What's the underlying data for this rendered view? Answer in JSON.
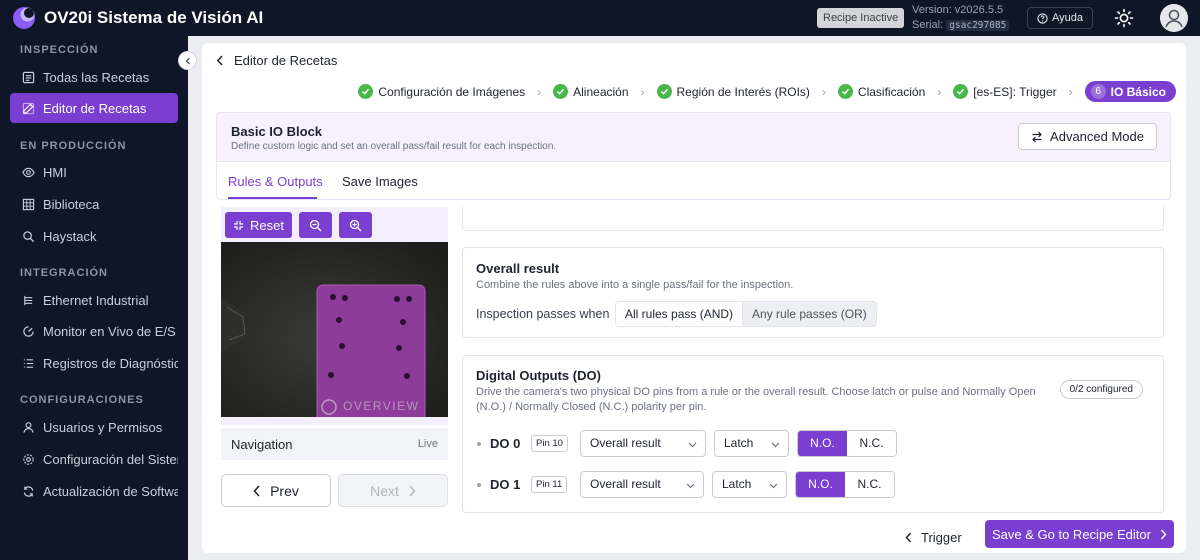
{
  "app": {
    "title": "OV20i Sistema de Visión AI",
    "recipe_status": "Recipe Inactive",
    "version": "Version: v2026.5.5",
    "serial_label": "Serial:",
    "serial_value": "gsac297085",
    "help_label": "Ayuda"
  },
  "sidebar": {
    "sections": [
      {
        "title": "INSPECCIÓN",
        "items": [
          {
            "label": "Todas las Recetas",
            "icon": "list-icon"
          },
          {
            "label": "Editor de Recetas",
            "icon": "edit-icon",
            "active": true
          }
        ]
      },
      {
        "title": "EN PRODUCCIÓN",
        "items": [
          {
            "label": "HMI",
            "icon": "eye-icon"
          },
          {
            "label": "Biblioteca",
            "icon": "grid-icon"
          },
          {
            "label": "Haystack",
            "icon": "search-icon"
          }
        ]
      },
      {
        "title": "INTEGRACIÓN",
        "items": [
          {
            "label": "Ethernet Industrial",
            "icon": "network-icon"
          },
          {
            "label": "Monitor en Vivo de E/S",
            "icon": "gauge-icon"
          },
          {
            "label": "Registros de Diagnóstico",
            "icon": "log-icon"
          }
        ]
      },
      {
        "title": "CONFIGURACIONES",
        "items": [
          {
            "label": "Usuarios y Permisos",
            "icon": "user-icon"
          },
          {
            "label": "Configuración del Sistema",
            "icon": "gear-icon"
          },
          {
            "label": "Actualización de Software",
            "icon": "refresh-icon"
          }
        ]
      }
    ]
  },
  "editor": {
    "back_label": "Editor de Recetas",
    "steps": [
      {
        "label": "Configuración de Imágenes",
        "done": true
      },
      {
        "label": "Alineación",
        "done": true
      },
      {
        "label": "Región de Interés (ROIs)",
        "done": true
      },
      {
        "label": "Clasificación",
        "done": true
      },
      {
        "label": "[es-ES]: Trigger",
        "done": true
      },
      {
        "label": "IO Básico",
        "number": "6",
        "current": true
      }
    ],
    "block": {
      "title": "Basic IO Block",
      "subtitle": "Define custom logic and set an overall pass/fail result for each inspection.",
      "advanced_label": "Advanced Mode"
    },
    "tabs": [
      "Rules & Outputs",
      "Save Images"
    ],
    "active_tab": "Rules & Outputs"
  },
  "viewer": {
    "reset_label": "Reset",
    "camera_watermark": "OVERVIEW",
    "navigation_label": "Navigation",
    "live_label": "Live",
    "prev_label": "Prev",
    "next_label": "Next"
  },
  "overall": {
    "title": "Overall result",
    "subtitle": "Combine the rules above into a single pass/fail for the inspection.",
    "passes_when_label": "Inspection passes when",
    "options": [
      "All rules pass (AND)",
      "Any rule passes (OR)"
    ],
    "selected": "All rules pass (AND)"
  },
  "digital_outputs": {
    "title": "Digital Outputs (DO)",
    "subtitle": "Drive the camera's two physical DO pins from a rule or the overall result. Choose latch or pulse and Normally Open (N.O.) / Normally Closed (N.C.) polarity per pin.",
    "configured_badge": "0/2 configured",
    "rows": [
      {
        "name": "DO 0",
        "pin": "Pin 10",
        "source": "Overall result",
        "mode": "Latch",
        "polarity_options": [
          "N.O.",
          "N.C."
        ],
        "polarity": "N.O."
      },
      {
        "name": "DO 1",
        "pin": "Pin 11",
        "source": "Overall result",
        "mode": "Latch",
        "polarity_options": [
          "N.O.",
          "N.C."
        ],
        "polarity": "N.O."
      }
    ]
  },
  "footer": {
    "back_label": "Trigger",
    "save_label": "Save & Go to Recipe Editor"
  },
  "colors": {
    "accent": "#7a3fd1",
    "sidebar_bg": "#0e1628",
    "success": "#49b64a"
  }
}
